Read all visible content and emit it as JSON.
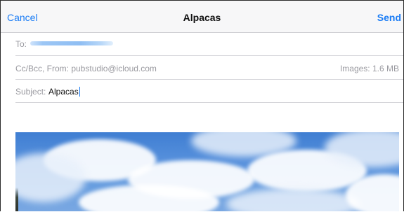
{
  "navbar": {
    "cancel_label": "Cancel",
    "title": "Alpacas",
    "send_label": "Send"
  },
  "to_field": {
    "label": "To:",
    "recipient": "recipient (blurred)"
  },
  "cc_field": {
    "label": "Cc/Bcc, From: pubstudio@icloud.com",
    "images_size": "Images: 1.6 MB"
  },
  "subject_field": {
    "label": "Subject:",
    "value": "Alpacas"
  },
  "colors": {
    "accent": "#1a7cf5",
    "navbar_bg": "#f7f7f8",
    "label_gray": "#9a9aa0",
    "divider": "#d6d6da",
    "sky_blue": "#5690dc"
  },
  "icons": {
    "photo": "sky-with-clouds-image"
  }
}
